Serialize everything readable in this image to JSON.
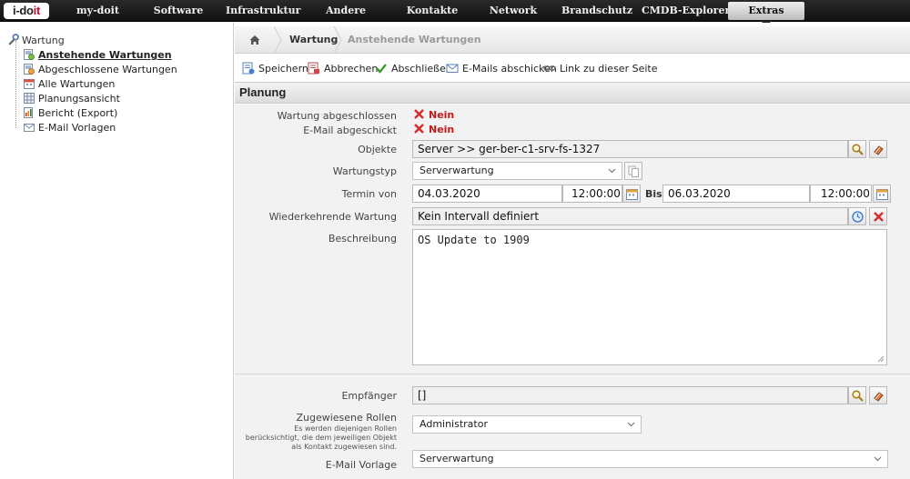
{
  "app": {
    "logo_text_main": "i-do",
    "logo_text_accent": "it"
  },
  "topnav": {
    "items": [
      {
        "label": "my-doit"
      },
      {
        "label": "Software"
      },
      {
        "label": "Infrastruktur"
      },
      {
        "label": "Andere"
      },
      {
        "label": "Kontakte"
      },
      {
        "label": "Network"
      },
      {
        "label": "Brandschutz"
      },
      {
        "label": "CMDB-Explorer"
      },
      {
        "label": "Extras",
        "active": true
      }
    ]
  },
  "sidebar": {
    "root": "Wartung",
    "items": [
      {
        "label": "Anstehende Wartungen",
        "active": true,
        "icon": "list-clock-icon"
      },
      {
        "label": "Abgeschlossene Wartungen",
        "icon": "list-check-icon"
      },
      {
        "label": "Alle Wartungen",
        "icon": "calendar-icon"
      },
      {
        "label": "Planungsansicht",
        "icon": "table-icon"
      },
      {
        "label": "Bericht (Export)",
        "icon": "report-icon"
      },
      {
        "label": "E-Mail Vorlagen",
        "icon": "mail-icon"
      }
    ]
  },
  "breadcrumb": {
    "items": [
      "Wartung",
      "Anstehende Wartungen"
    ]
  },
  "toolbar": {
    "save": "Speichern",
    "cancel": "Abbrechen",
    "complete": "Abschließen",
    "send_mails": "E-Mails abschicken",
    "link": "Link zu dieser Seite"
  },
  "section": {
    "title": "Planung"
  },
  "form": {
    "completed": {
      "label": "Wartung abgeschlossen",
      "value": "Nein"
    },
    "mail_sent": {
      "label": "E-Mail abgeschickt",
      "value": "Nein"
    },
    "objects": {
      "label": "Objekte",
      "value": "Server >>  ger-ber-c1-srv-fs-1327"
    },
    "type": {
      "label": "Wartungstyp",
      "value": "Serverwartung"
    },
    "term": {
      "label": "Termin von",
      "from_date": "04.03.2020",
      "from_time": "12:00:00",
      "to_label": "Bis",
      "to_date": "06.03.2020",
      "to_time": "12:00:00"
    },
    "recurring": {
      "label": "Wiederkehrende Wartung",
      "value": "Kein Intervall definiert"
    },
    "description": {
      "label": "Beschreibung",
      "value": "OS Update to 1909"
    },
    "recipients": {
      "label": "Empfänger",
      "value": "[]"
    },
    "roles": {
      "label": "Zugewiesene Rollen",
      "hint": "Es werden diejenigen Rollen berücksichtigt, die dem jeweiligen Objekt als Kontakt zugewiesen sind.",
      "value": "Administrator"
    },
    "mail_template": {
      "label": "E-Mail Vorlage",
      "value": "Serverwartung"
    }
  },
  "colors": {
    "nav_bg": "#1a1a1a",
    "status_red": "#c41a1a",
    "form_bg": "#f2f2f2"
  }
}
